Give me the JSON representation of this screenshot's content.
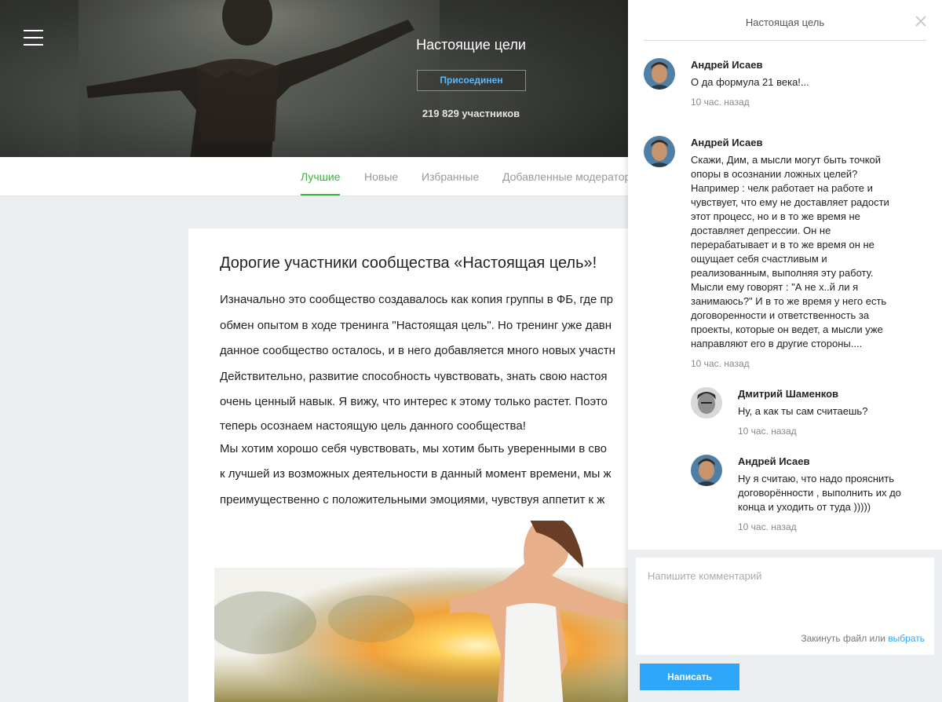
{
  "hero": {
    "title": "Настоящие цели",
    "join_label": "Присоединен",
    "members": "219 829 участников"
  },
  "tabs": [
    {
      "label": "Лучшие",
      "active": true
    },
    {
      "label": "Новые",
      "active": false
    },
    {
      "label": "Избранные",
      "active": false
    },
    {
      "label": "Добавленные модератор",
      "active": false
    }
  ],
  "post": {
    "title": "Дорогие участники сообщества «Настоящая цель»!",
    "lines": [
      "Изначально это сообщество создавалось как копия группы в ФБ, где пр",
      "обмен опытом в ходе тренинга \"Настоящая цель\". Но тренинг уже давн",
      "данное сообщество осталось, и в него добавляется много новых участн",
      "Действительно, развитие способность чувствовать, знать свою настоя",
      "очень ценный навык. Я вижу, что интерес к этому только растет. Поэто",
      "теперь осознаем настоящую цель данного сообщества!",
      "Мы хотим хорошо себя чувствовать, мы хотим быть уверенными в сво",
      "к лучшей из возможных деятельности в данный момент времени, мы ж",
      "преимущественно с положительными эмоциями, чувствуя аппетит к ж"
    ]
  },
  "panel": {
    "title": "Настоящая цель",
    "comments": [
      {
        "author": "Андрей Исаев",
        "lines": [
          "О да формула 21 века!..."
        ],
        "time": "10 час. назад"
      },
      {
        "author": "Андрей Исаев",
        "lines": [
          "Скажи, Дим, а мысли могут быть точкой",
          "опоры в осознании ложных целей?",
          "Например : челк работает на работе и",
          "чувствует, что ему не доставляет радости",
          "этот процесс, но и в то же время не",
          "доставляет депрессии. Он не",
          "перерабатывает и в то же время он не",
          "ощущает себя счастливым и",
          "реализованным, выполняя эту работу.",
          "Мысли ему говорят : \"А не х..й ли я",
          "занимаюсь?\" И в то же время у него есть",
          "договоренности и ответственность за",
          "проекты, которые он ведет, а мысли уже",
          "направляют его в другие стороны...."
        ],
        "time": "10 час. назад"
      },
      {
        "author": "Дмитрий Шаменков",
        "lines": [
          "Ну, а как ты сам считаешь?"
        ],
        "time": "10 час. назад"
      },
      {
        "author": "Андрей Исаев",
        "lines": [
          "Ну я считаю, что надо прояснить",
          "договорённости , выполнить их до",
          "конца и уходить от туда )))))"
        ],
        "time": "10 час. назад"
      }
    ],
    "composer": {
      "placeholder": "Напишите комментарий",
      "attach_text": "Закинуть файл или",
      "attach_link": "выбрать",
      "send_label": "Написать"
    }
  },
  "colors": {
    "accent_green": "#3bb03f",
    "accent_blue": "#2ea7f8",
    "page_bg": "#eceff1"
  },
  "icons": {
    "menu": "hamburger-icon",
    "close": "close-icon"
  }
}
